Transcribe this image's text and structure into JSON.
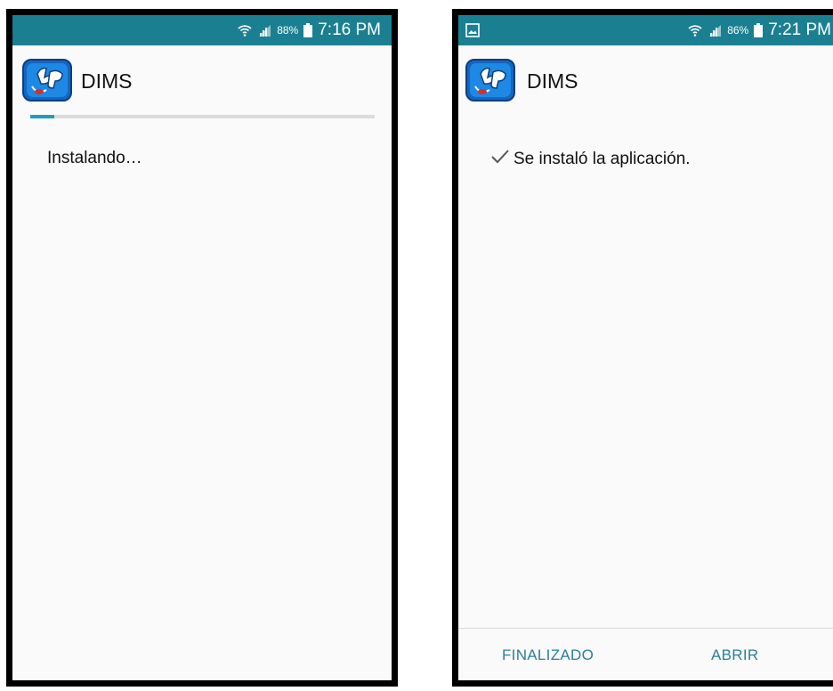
{
  "left_screen": {
    "status": {
      "battery": "88%",
      "time": "7:16 PM"
    },
    "app_name": "DIMS",
    "progress": 0.07,
    "message": "Instalando…"
  },
  "right_screen": {
    "status": {
      "battery": "86%",
      "time": "7:21 PM"
    },
    "app_name": "DIMS",
    "message": "Se instaló la aplicación.",
    "buttons": {
      "done": "FINALIZADO",
      "open": "ABRIR"
    }
  },
  "colors": {
    "statusbar": "#1b7f92",
    "progress": "#1e9dc0",
    "button_text": "#2a7f99",
    "logo_blue": "#1565c0"
  },
  "icons": [
    "wifi-icon",
    "signal-icon",
    "battery-icon",
    "gallery-notification-icon",
    "check-icon",
    "dims-logo"
  ]
}
